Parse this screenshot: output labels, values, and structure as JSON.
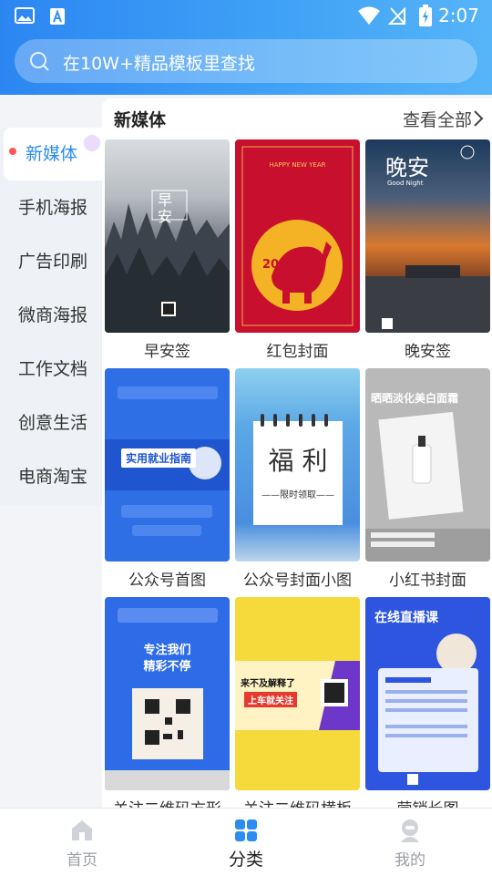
{
  "status_bar": {
    "time": "2:07"
  },
  "search": {
    "placeholder": "在10W+精品模板里查找"
  },
  "sidebar": {
    "items": [
      {
        "label": "新媒体",
        "active": true
      },
      {
        "label": "手机海报"
      },
      {
        "label": "广告印刷"
      },
      {
        "label": "微商海报"
      },
      {
        "label": "工作文档"
      },
      {
        "label": "创意生活"
      },
      {
        "label": "电商淘宝"
      }
    ]
  },
  "section": {
    "title": "新媒体",
    "view_all": "查看全部"
  },
  "templates": [
    {
      "label": "早安签",
      "texts": [
        "早安"
      ]
    },
    {
      "label": "红包封面",
      "texts": [
        "HAPPY NEW YEAR",
        "2021"
      ]
    },
    {
      "label": "晚安签",
      "texts": [
        "晚安",
        "Good Night"
      ]
    },
    {
      "label": "公众号首图",
      "texts": [
        "实用就业指南"
      ]
    },
    {
      "label": "公众号封面小图",
      "texts": [
        "福 利",
        "——限时领取——"
      ]
    },
    {
      "label": "小红书封面",
      "texts": [
        "晒晒淡化美白面霜"
      ]
    },
    {
      "label": "关注二维码方形",
      "texts": [
        "专注我们",
        "精彩不停"
      ]
    },
    {
      "label": "关注二维码横板",
      "texts": [
        "来不及解释了",
        "上车就关注"
      ]
    },
    {
      "label": "营销长图",
      "texts": [
        "在线直播课"
      ]
    }
  ],
  "bottom_nav": {
    "items": [
      {
        "label": "首页",
        "icon": "home-icon"
      },
      {
        "label": "分类",
        "icon": "category-icon",
        "active": true
      },
      {
        "label": "我的",
        "icon": "profile-icon"
      }
    ]
  },
  "colors": {
    "accent": "#2d8cf0",
    "header_start": "#2c86f2",
    "header_end": "#56b4f8"
  }
}
